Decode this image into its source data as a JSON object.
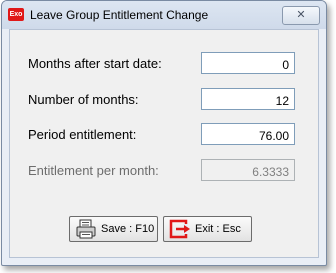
{
  "window": {
    "title": "Leave Group Entitlement Change",
    "app_icon_text": "Exo",
    "close_glyph": "✕"
  },
  "form": {
    "months_after_start_label": "Months after start date:",
    "months_after_start_value": "0",
    "number_of_months_label": "Number of months:",
    "number_of_months_value": "12",
    "period_entitlement_label": "Period entitlement:",
    "period_entitlement_value": "76.00",
    "entitlement_per_month_label": "Entitlement per month:",
    "entitlement_per_month_value": "6.3333"
  },
  "buttons": {
    "save_label": "Save : F10",
    "exit_label": "Exit : Esc"
  },
  "colors": {
    "exit_icon": "#e01818",
    "app_icon": "#e01818"
  }
}
